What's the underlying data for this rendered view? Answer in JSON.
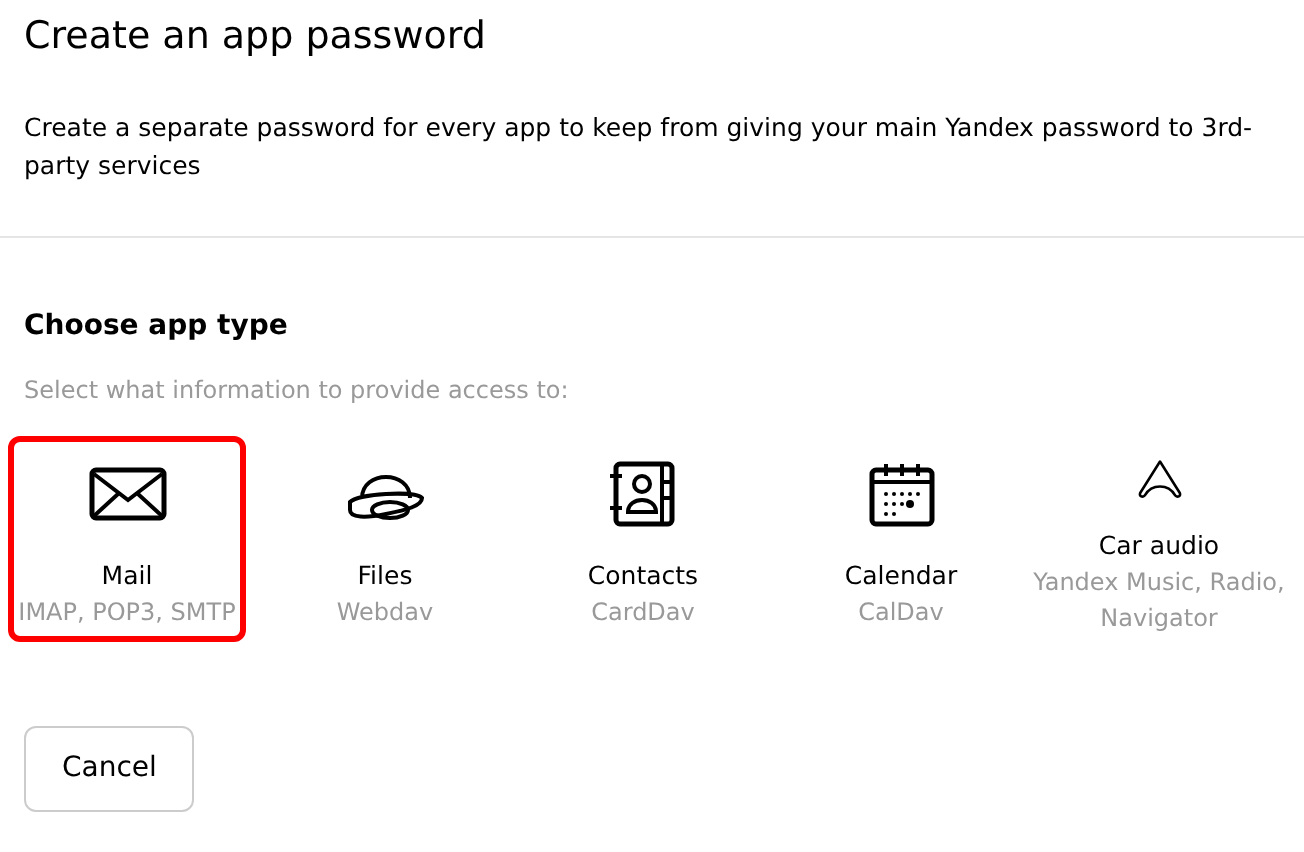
{
  "title": "Create an app password",
  "description": "Create a separate password for every app to keep from giving your main Yandex password to 3rd-party services",
  "section": {
    "heading": "Choose app type",
    "hint": "Select what information to provide access to:"
  },
  "app_types": [
    {
      "kind": "mail",
      "label": "Mail",
      "protocols": "IMAP, POP3, SMTP",
      "selected": true
    },
    {
      "kind": "files",
      "label": "Files",
      "protocols": "Webdav",
      "selected": false
    },
    {
      "kind": "contacts",
      "label": "Contacts",
      "protocols": "CardDav",
      "selected": false
    },
    {
      "kind": "calendar",
      "label": "Calendar",
      "protocols": "CalDav",
      "selected": false
    },
    {
      "kind": "car",
      "label": "Car audio",
      "protocols": "Yandex Music, Radio, Navigator",
      "selected": false
    }
  ],
  "buttons": [
    {
      "label": "Cancel"
    }
  ]
}
